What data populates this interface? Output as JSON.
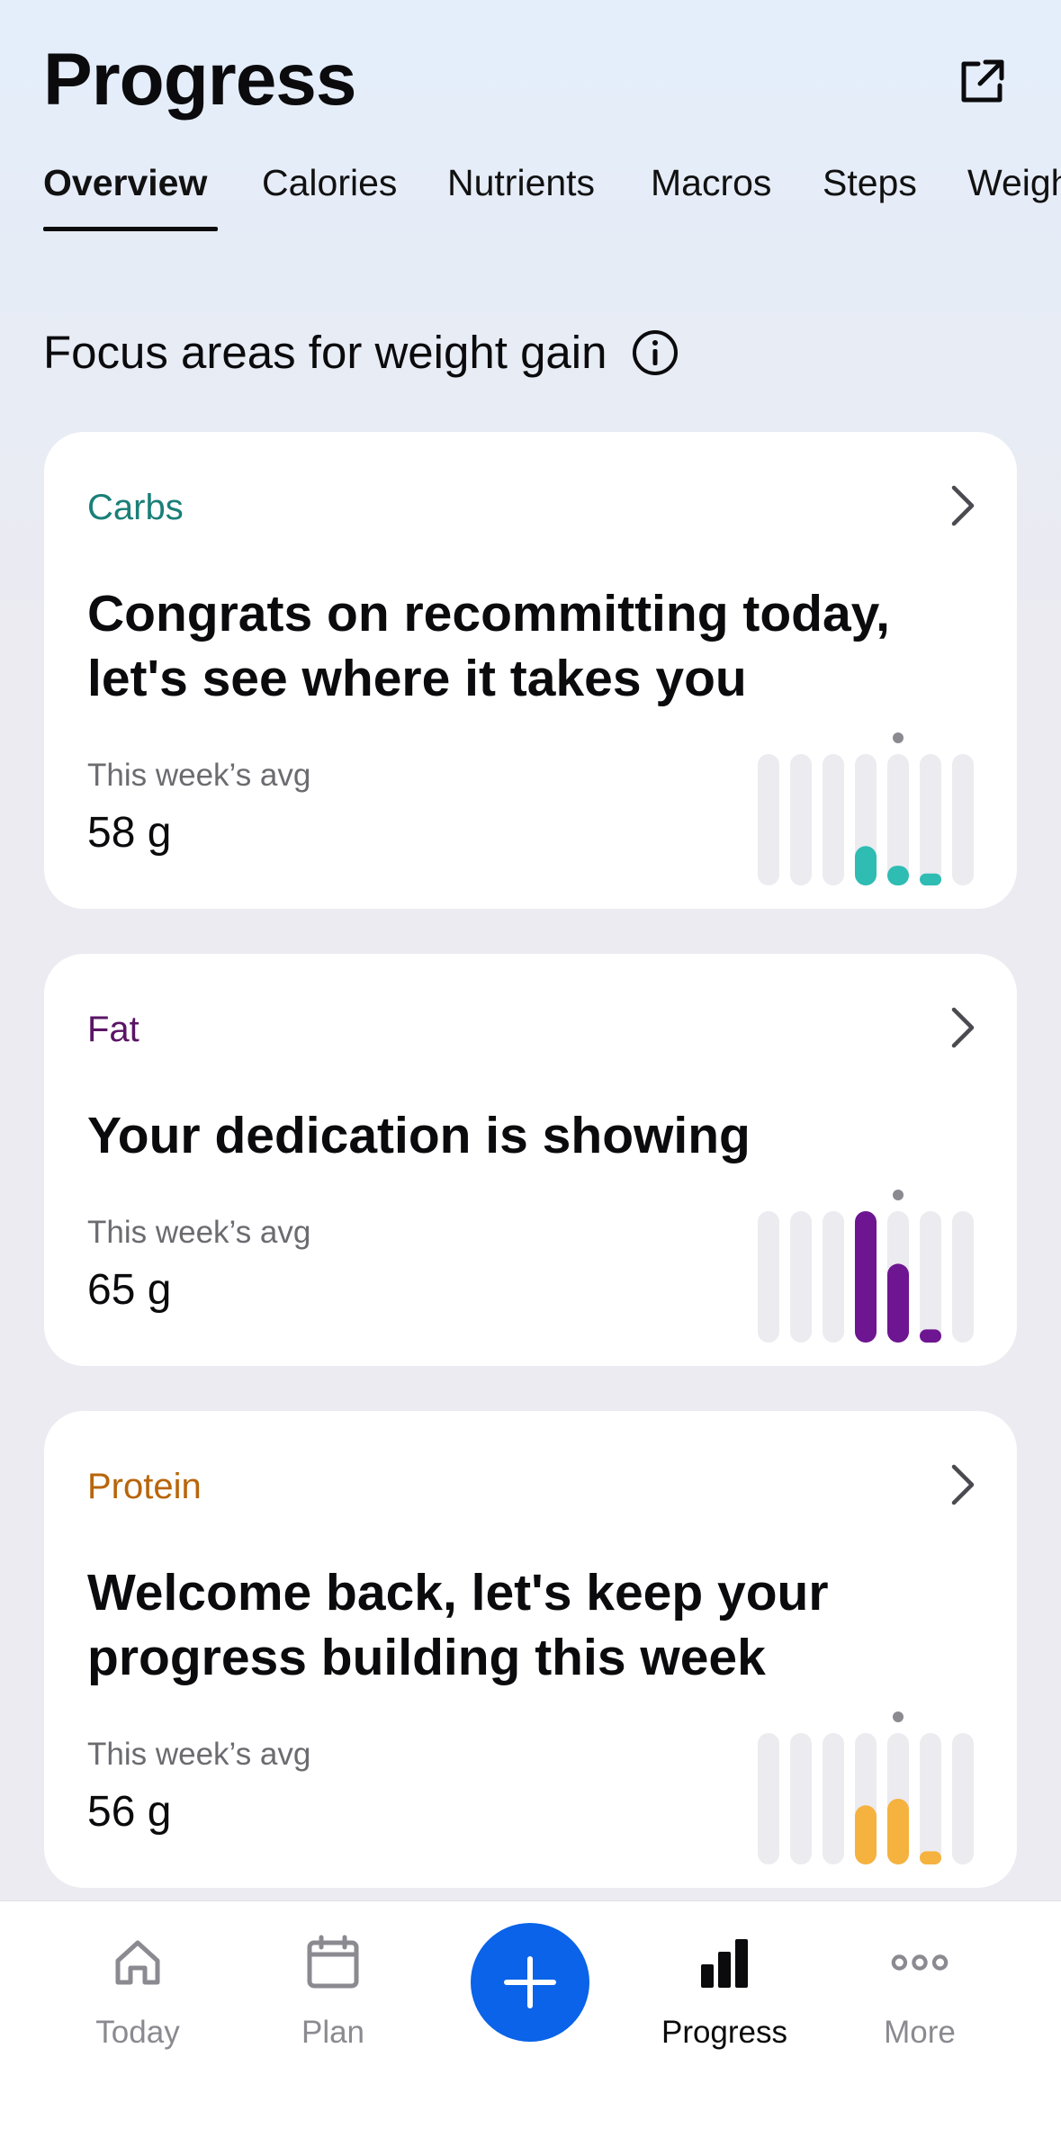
{
  "header": {
    "title": "Progress",
    "share_icon": "share-external-icon"
  },
  "tabs": [
    {
      "label": "Overview",
      "active": true
    },
    {
      "label": "Calories"
    },
    {
      "label": "Nutrients"
    },
    {
      "label": "Macros"
    },
    {
      "label": "Steps"
    },
    {
      "label": "Weight"
    }
  ],
  "section": {
    "title": "Focus areas for weight gain",
    "info_icon": "info-icon"
  },
  "cards": [
    {
      "tag": "Carbs",
      "color": "#1a7f78",
      "bar_color": "#2ebcb3",
      "headline": "Congrats on recommitting today, let's see where it takes you",
      "avg_label": "This week’s avg",
      "avg_value": "58 g",
      "week_levels": [
        0,
        0,
        0,
        0.3,
        0.15,
        0.03,
        0
      ],
      "today_index": 4
    },
    {
      "tag": "Fat",
      "color": "#5a1466",
      "bar_color": "#6e1591",
      "headline": "Your dedication is showing",
      "avg_label": "This week’s avg",
      "avg_value": "65 g",
      "week_levels": [
        0,
        0,
        0,
        1.0,
        0.6,
        0.1,
        0
      ],
      "today_index": 4
    },
    {
      "tag": "Protein",
      "color": "#b8650b",
      "bar_color": "#f5b23e",
      "headline": "Welcome back, let's keep your progress building this week",
      "avg_label": "This week’s avg",
      "avg_value": "56 g",
      "week_levels": [
        0,
        0,
        0,
        0.45,
        0.5,
        0.1,
        0
      ],
      "today_index": 4
    }
  ],
  "bottom_nav": [
    {
      "label": "Today",
      "icon": "home-icon"
    },
    {
      "label": "Plan",
      "icon": "calendar-icon"
    },
    {
      "label": "",
      "icon": "plus-icon"
    },
    {
      "label": "Progress",
      "icon": "bar-chart-icon",
      "active": true
    },
    {
      "label": "More",
      "icon": "more-dots-icon"
    }
  ],
  "colors": {
    "accent": "#0a63e8",
    "bar_track": "#ebebf0"
  }
}
